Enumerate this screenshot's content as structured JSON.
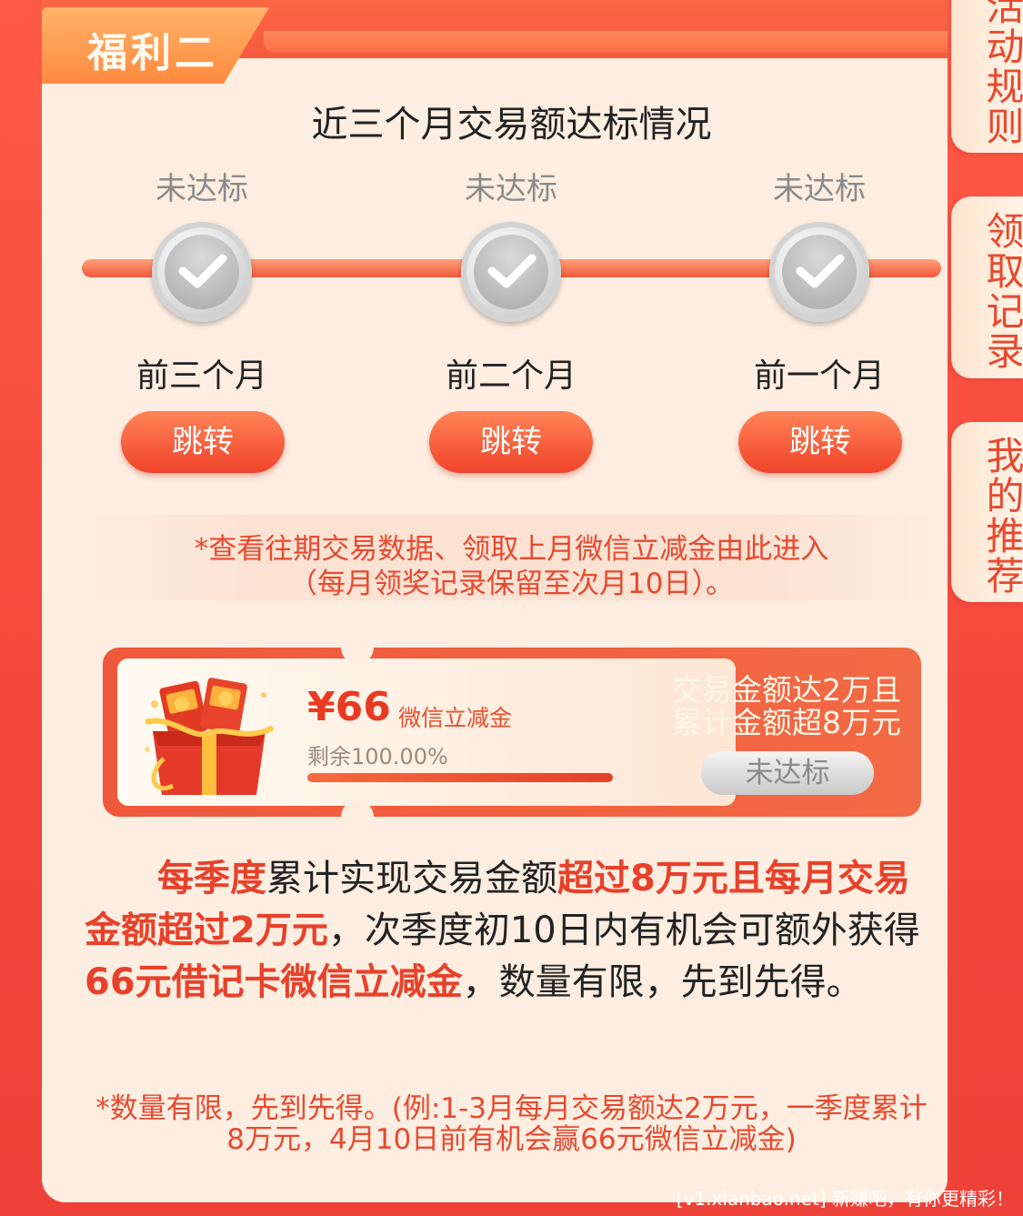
{
  "header": {
    "tag_label": "福利二",
    "title": "近三个月交易额达标情况"
  },
  "months": [
    {
      "status": "未达标",
      "label": "前三个月",
      "button": "跳转"
    },
    {
      "status": "未达标",
      "label": "前二个月",
      "button": "跳转"
    },
    {
      "status": "未达标",
      "label": "前一个月",
      "button": "跳转"
    }
  ],
  "notice": {
    "line1": "*查看往期交易数据、领取上月微信立减金由此进入",
    "line2": "（每月领奖记录保留至次月10日）。"
  },
  "coupon": {
    "amount": "¥66",
    "amount_desc": "微信立减金",
    "remain": "剩余100.00%",
    "remain_fraction": 1.0,
    "condition_line1": "交易金额达2万且",
    "condition_line2": "累计金额超8万元",
    "status_button": "未达标"
  },
  "description": {
    "p1_hl": "每季度",
    "p2": "累计实现交易金额",
    "p3_hl": "超过8万元且每月交易金额超过2万元",
    "p4": "，次季度初10日内有机会可额外获得",
    "p5_hl": "66元借记卡微信立减金",
    "p6": "，数量有限，先到先得。"
  },
  "footnote": {
    "line1": "*数量有限，先到先得。(例:1-3月每月交易额达2万元，一季度累计",
    "line2": "8万元，4月10日前有机会赢66元微信立减金)"
  },
  "side_tabs": [
    {
      "label": "活动规则"
    },
    {
      "label": "领取记录"
    },
    {
      "label": "我的推荐"
    }
  ],
  "watermark": "[v1.xianbao.net] 新赚吧，有你更精彩！"
}
